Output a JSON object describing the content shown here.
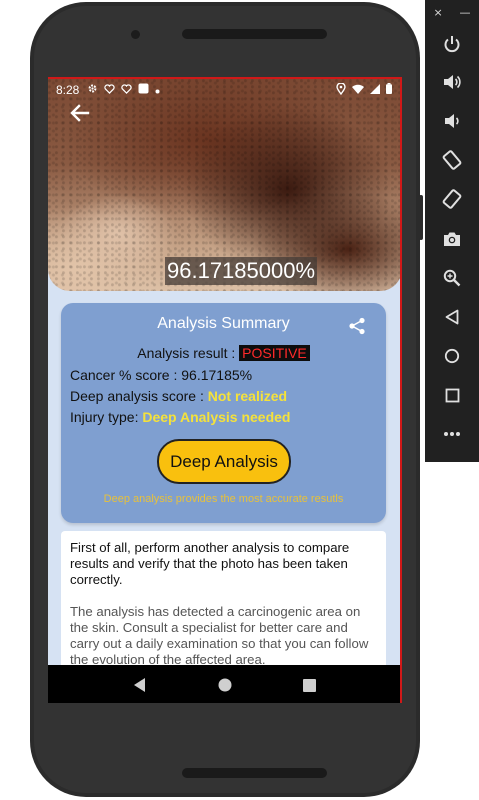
{
  "status_bar": {
    "time": "8:28",
    "left_icons": [
      "gear-icon",
      "heart-outline-icon",
      "heart-outline-icon",
      "square-icon",
      "dot-icon"
    ],
    "right_icons": [
      "location-icon",
      "wifi-icon",
      "signal-icon",
      "battery-icon"
    ]
  },
  "hero": {
    "score_text": "96.17185000%"
  },
  "summary": {
    "title": "Analysis Summary",
    "result_label": "Analysis result : ",
    "result_value": "POSITIVE",
    "cancer_score_line": "Cancer % score : 96.17185%",
    "deep_score_label": "Deep analysis score : ",
    "deep_score_value": "Not realized",
    "injury_label": "Injury type: ",
    "injury_value": "Deep Analysis needed",
    "deep_button_label": "Deep Analysis",
    "hint": "Deep analysis provides the most accurate resutls",
    "accent_color": "#7f9fd0",
    "button_color": "#f9c00e",
    "positive_color": "#ff2a2a",
    "highlight_color": "#f5e23a"
  },
  "advice": {
    "paragraph_1": "First of all, perform another analysis to compare results and verify that the photo has been taken correctly.",
    "paragraph_2": "The analysis has detected a carcinogenic area on the skin. Consult a specialist for better care and carry out a daily examination so that you can follow the evolution of the affected area."
  },
  "emulator_toolbar": {
    "window_controls": [
      "×",
      "—"
    ],
    "buttons": [
      "power-icon",
      "volume-up-icon",
      "volume-down-icon",
      "rotate-left-icon",
      "rotate-right-icon",
      "camera-icon",
      "zoom-icon",
      "back-icon",
      "home-icon",
      "overview-icon",
      "more-icon"
    ]
  }
}
